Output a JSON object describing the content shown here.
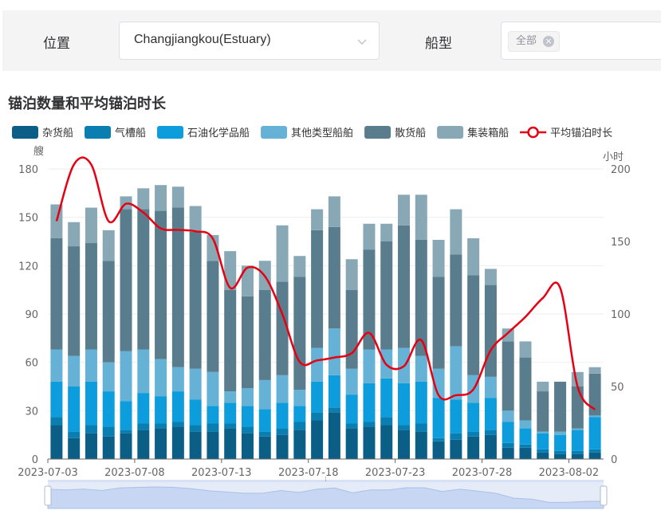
{
  "filters": {
    "location_label": "位置",
    "location_value": "Changjiangkou(Estuary)",
    "ship_type_label": "船型",
    "ship_type_tag": "全部"
  },
  "chart_title": "锚泊数量和平均锚泊时长",
  "chart_title_2": "",
  "colors": {
    "series": [
      "#0b5f86",
      "#0a7eb1",
      "#0d9ddc",
      "#66b2d6",
      "#5a7d8e",
      "#88a8b6"
    ],
    "line": "#e60012",
    "axis": "#666666",
    "grid": "#eeeeee",
    "slider_fill": "#c7d7f3",
    "slider_bg": "#e6ecf7"
  },
  "chart_data": {
    "type": "bar",
    "stacked": true,
    "legend_position": "top",
    "grid": true,
    "y_left": {
      "label": "艘",
      "ylim": [
        0,
        180
      ],
      "ticks": [
        0,
        30,
        60,
        90,
        120,
        150,
        180
      ]
    },
    "y_right": {
      "label": "小时",
      "ylim": [
        0,
        200
      ],
      "ticks": [
        0,
        50,
        100,
        150,
        200
      ]
    },
    "x_ticks": [
      "2023-07-03",
      "2023-07-08",
      "2023-07-13",
      "2023-07-18",
      "2023-07-23",
      "2023-07-28",
      "2023-08-02"
    ],
    "categories": [
      "2023-07-03",
      "2023-07-04",
      "2023-07-05",
      "2023-07-06",
      "2023-07-07",
      "2023-07-08",
      "2023-07-09",
      "2023-07-10",
      "2023-07-11",
      "2023-07-12",
      "2023-07-13",
      "2023-07-14",
      "2023-07-15",
      "2023-07-16",
      "2023-07-17",
      "2023-07-18",
      "2023-07-19",
      "2023-07-20",
      "2023-07-21",
      "2023-07-22",
      "2023-07-23",
      "2023-07-24",
      "2023-07-25",
      "2023-07-26",
      "2023-07-27",
      "2023-07-28",
      "2023-07-29",
      "2023-07-30",
      "2023-07-31",
      "2023-08-01",
      "2023-08-02",
      "2023-08-03"
    ],
    "series": [
      {
        "name": "杂货船",
        "axis": "left",
        "values": [
          21,
          13,
          16,
          14,
          16,
          18,
          19,
          20,
          17,
          17,
          19,
          16,
          14,
          15,
          18,
          24,
          29,
          19,
          20,
          21,
          18,
          17,
          11,
          12,
          14,
          15,
          7,
          7,
          4,
          3,
          3,
          4
        ]
      },
      {
        "name": "气槽船",
        "axis": "left",
        "values": [
          5,
          4,
          5,
          6,
          2,
          4,
          3,
          3,
          4,
          5,
          3,
          4,
          3,
          4,
          5,
          5,
          3,
          3,
          3,
          5,
          3,
          5,
          2,
          4,
          3,
          3,
          3,
          2,
          2,
          2,
          2,
          2
        ]
      },
      {
        "name": "石油化学品船",
        "axis": "left",
        "values": [
          22,
          28,
          27,
          22,
          18,
          19,
          17,
          19,
          16,
          11,
          13,
          13,
          14,
          16,
          10,
          19,
          20,
          18,
          24,
          24,
          26,
          26,
          25,
          21,
          18,
          20,
          13,
          10,
          10,
          10,
          13,
          20
        ]
      },
      {
        "name": "其他类型船舶",
        "axis": "left",
        "values": [
          20,
          19,
          20,
          18,
          31,
          27,
          23,
          15,
          19,
          21,
          7,
          11,
          18,
          17,
          10,
          21,
          29,
          16,
          21,
          18,
          22,
          16,
          18,
          33,
          17,
          13,
          7,
          5,
          1,
          2,
          1,
          1
        ]
      },
      {
        "name": "散货船",
        "axis": "left",
        "values": [
          69,
          68,
          66,
          63,
          88,
          87,
          92,
          99,
          85,
          69,
          63,
          57,
          56,
          58,
          70,
          73,
          63,
          49,
          62,
          67,
          76,
          72,
          57,
          57,
          62,
          57,
          43,
          39,
          25,
          31,
          26,
          26
        ]
      },
      {
        "name": "集装箱船",
        "axis": "left",
        "values": [
          21,
          15,
          22,
          19,
          8,
          13,
          16,
          13,
          16,
          16,
          24,
          19,
          18,
          35,
          13,
          13,
          19,
          19,
          16,
          11,
          19,
          28,
          23,
          28,
          23,
          10,
          8,
          10,
          6,
          0,
          9,
          4
        ]
      }
    ],
    "line": {
      "name": "平均锚泊时长",
      "axis": "right",
      "values": [
        164,
        203,
        203,
        164,
        176,
        170,
        159,
        158,
        157,
        152,
        118,
        132,
        126,
        100,
        67,
        68,
        70,
        73,
        87,
        65,
        64,
        82,
        44,
        44,
        48,
        75,
        87,
        98,
        111,
        118,
        50,
        34
      ]
    }
  },
  "slider": {
    "handle_glyph": "⁞",
    "overview_values": [
      150,
      145,
      152,
      140,
      160,
      165,
      168,
      165,
      155,
      138,
      128,
      118,
      120,
      140,
      125,
      150,
      160,
      122,
      145,
      145,
      162,
      162,
      133,
      150,
      135,
      118,
      80,
      72,
      47,
      48,
      55,
      57
    ]
  }
}
